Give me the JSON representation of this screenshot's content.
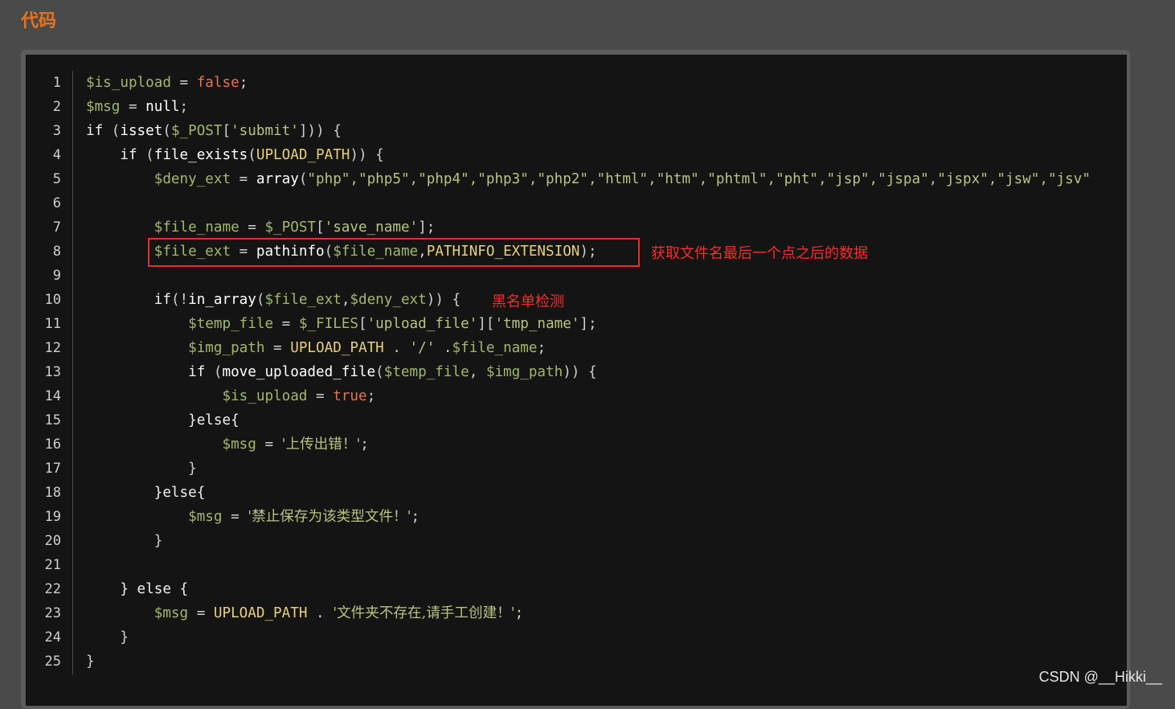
{
  "heading": "代码",
  "line_numbers": [
    "1",
    "2",
    "3",
    "4",
    "5",
    "6",
    "7",
    "8",
    "9",
    "10",
    "11",
    "12",
    "13",
    "14",
    "15",
    "16",
    "17",
    "18",
    "19",
    "20",
    "21",
    "22",
    "23",
    "24",
    "25"
  ],
  "code": {
    "l1": {
      "a": "$is_upload",
      "b": " = ",
      "c": "false",
      "d": ";"
    },
    "l2": {
      "a": "$msg",
      "b": " = ",
      "c": "null",
      "d": ";"
    },
    "l3": {
      "a": "if ",
      "b": "(",
      "c": "isset",
      "d": "(",
      "e": "$_POST",
      "f": "[",
      "g": "'submit'",
      "h": "])) {"
    },
    "l4": {
      "a": "    if ",
      "b": "(",
      "c": "file_exists",
      "d": "(",
      "e": "UPLOAD_PATH",
      "f": ")) {"
    },
    "l5": {
      "a": "        $deny_ext",
      "b": " = ",
      "c": "array",
      "d": "(",
      "e": "\"php\",\"php5\",\"php4\",\"php3\",\"php2\",\"html\",\"htm\",\"phtml\",\"pht\",\"jsp\",\"jspa\",\"jspx\",\"jsw\",\"jsv\""
    },
    "l7": {
      "a": "        $file_name",
      "b": " = ",
      "c": "$_POST",
      "d": "[",
      "e": "'save_name'",
      "f": "];"
    },
    "l8": {
      "a": "        $file_ext",
      "b": " = ",
      "c": "pathinfo",
      "d": "(",
      "e": "$file_name",
      "f": ",",
      "g": "PATHINFO_EXTENSION",
      "h": ");"
    },
    "l10": {
      "a": "        if",
      "b": "(!",
      "c": "in_array",
      "d": "(",
      "e": "$file_ext",
      "f": ",",
      "g": "$deny_ext",
      "h": ")) {"
    },
    "l11": {
      "a": "            $temp_file",
      "b": " = ",
      "c": "$_FILES",
      "d": "[",
      "e": "'upload_file'",
      "f": "][",
      "g": "'tmp_name'",
      "h": "];"
    },
    "l12": {
      "a": "            $img_path",
      "b": " = ",
      "c": "UPLOAD_PATH",
      "d": " . ",
      "e": "'/'",
      "f": " .",
      "g": "$file_name",
      "h": ";"
    },
    "l13": {
      "a": "            if ",
      "b": "(",
      "c": "move_uploaded_file",
      "d": "(",
      "e": "$temp_file",
      "f": ", ",
      "g": "$img_path",
      "h": ")) {"
    },
    "l14": {
      "a": "                $is_upload",
      "b": " = ",
      "c": "true",
      "d": ";"
    },
    "l15": {
      "a": "            }else{"
    },
    "l16": {
      "a": "                $msg",
      "b": " = ",
      "c": "'上传出错！'",
      "d": ";"
    },
    "l17": {
      "a": "            }"
    },
    "l18": {
      "a": "        }else{"
    },
    "l19": {
      "a": "            $msg",
      "b": " = ",
      "c": "'禁止保存为该类型文件！'",
      "d": ";"
    },
    "l20": {
      "a": "        }"
    },
    "l22": {
      "a": "    } else {"
    },
    "l23": {
      "a": "        $msg",
      "b": " = ",
      "c": "UPLOAD_PATH",
      "d": " . ",
      "e": "'文件夹不存在,请手工创建！'",
      "f": ";"
    },
    "l24": {
      "a": "    }"
    },
    "l25": {
      "a": "}"
    }
  },
  "annotations": {
    "note1": "获取文件名最后一个点之后的数据",
    "note2": "黑名单检测"
  },
  "watermark": "CSDN @__Hikki__",
  "colors": {
    "heading": "#e8731e",
    "annotation": "#ff2a2a",
    "background": "#141414"
  }
}
